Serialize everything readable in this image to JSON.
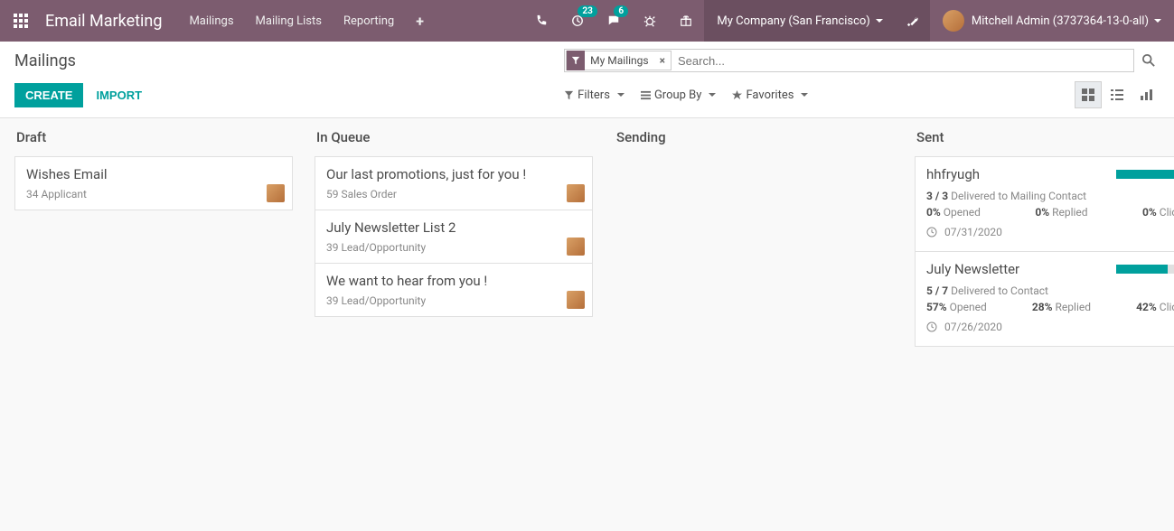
{
  "header": {
    "app_title": "Email Marketing",
    "menus": [
      "Mailings",
      "Mailing Lists",
      "Reporting"
    ],
    "activities_count": "23",
    "discuss_count": "6",
    "company": "My Company (San Francisco)",
    "user": "Mitchell Admin (3737364-13-0-all)"
  },
  "controls": {
    "breadcrumb": "Mailings",
    "create": "CREATE",
    "import": "IMPORT",
    "search_facet": "My Mailings",
    "search_placeholder": "Search...",
    "filters": "Filters",
    "groupby": "Group By",
    "favorites": "Favorites"
  },
  "columns": {
    "draft": "Draft",
    "queue": "In Queue",
    "sending": "Sending",
    "sent": "Sent"
  },
  "draft": [
    {
      "title": "Wishes Email",
      "sub": "34 Applicant"
    }
  ],
  "queue": [
    {
      "title": "Our last promotions, just for you !",
      "sub": "59 Sales Order"
    },
    {
      "title": "July Newsletter List 2",
      "sub": "39 Lead/Opportunity"
    },
    {
      "title": "We want to hear from you !",
      "sub": "39 Lead/Opportunity"
    }
  ],
  "sent": [
    {
      "title": "hhfryugh",
      "progress_pct": 100,
      "delivered_num": "3 / 3",
      "delivered_label": "Delivered to Mailing Contact",
      "opened_pct": "0%",
      "opened_label": "Opened",
      "replied_pct": "0%",
      "replied_label": "Replied",
      "clicks_pct": "0%",
      "clicks_label": "Clicks",
      "date": "07/31/2020"
    },
    {
      "title": "July Newsletter",
      "progress_pct": 71,
      "delivered_num": "5 / 7",
      "delivered_label": "Delivered to Contact",
      "opened_pct": "57%",
      "opened_label": "Opened",
      "replied_pct": "28%",
      "replied_label": "Replied",
      "clicks_pct": "42%",
      "clicks_label": "Clicks",
      "date": "07/26/2020"
    }
  ]
}
